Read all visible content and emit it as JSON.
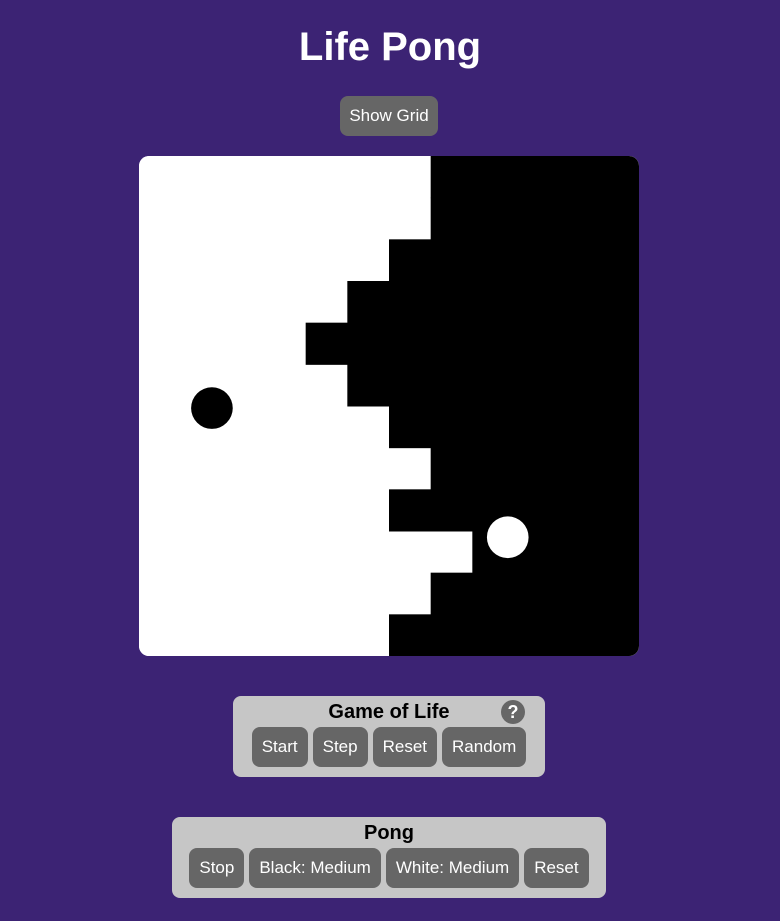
{
  "app": {
    "title": "Life Pong"
  },
  "controls": {
    "show_grid_label": "Show Grid"
  },
  "game_of_life": {
    "title": "Game of Life",
    "help_label": "?",
    "buttons": [
      "Start",
      "Step",
      "Reset",
      "Random"
    ]
  },
  "pong": {
    "title": "Pong",
    "buttons": [
      "Stop",
      "Black: Medium",
      "White: Medium",
      "Reset"
    ]
  },
  "board": {
    "grid_size": 12,
    "owner_colors": {
      "white": "#ffffff",
      "black": "#000000"
    },
    "boundary_cols_per_row": [
      7,
      7,
      6,
      5,
      4,
      5,
      6,
      7,
      6,
      8,
      7,
      6
    ],
    "balls": [
      {
        "name": "black-ball",
        "color": "#000000",
        "cell": [
          1.75,
          6.05
        ]
      },
      {
        "name": "white-ball",
        "color": "#ffffff",
        "cell": [
          8.85,
          9.15
        ]
      }
    ]
  },
  "colors": {
    "background": "#3c2374",
    "button": "#666666",
    "panel": "#c6c6c6"
  }
}
